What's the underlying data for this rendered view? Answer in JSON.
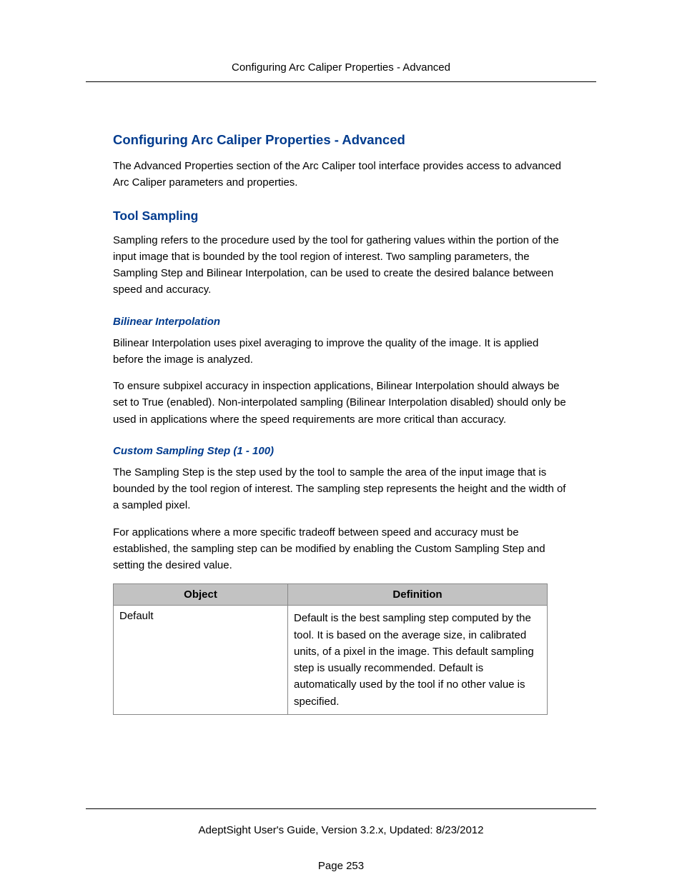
{
  "header": {
    "running_title": "Configuring Arc Caliper Properties - Advanced"
  },
  "content": {
    "h1": "Configuring Arc Caliper Properties - Advanced",
    "intro": "The Advanced Properties section of the Arc Caliper tool interface provides access to advanced Arc Caliper parameters and properties.",
    "h2_tool_sampling": "Tool Sampling",
    "tool_sampling_para": "Sampling refers to the procedure used by the tool for gathering values within the portion of the input image that is bounded by the tool region of interest. Two sampling parameters, the Sampling Step and Bilinear Interpolation, can be used to create the desired balance between speed and accuracy.",
    "h3_bilinear": "Bilinear Interpolation",
    "bilinear_p1": "Bilinear Interpolation uses pixel averaging to improve the quality of the image. It is applied before the image is analyzed.",
    "bilinear_p2": "To ensure subpixel accuracy in inspection applications, Bilinear Interpolation should always be set to True (enabled). Non-interpolated sampling (Bilinear Interpolation disabled) should only be used in applications where the speed requirements are more critical than accuracy.",
    "h3_custom": "Custom Sampling Step (1 - 100)",
    "custom_p1": "The Sampling Step is the step used by the tool to sample the area of the input image that is bounded by the tool region of interest. The sampling step represents the height and the width of a sampled pixel.",
    "custom_p2": "For applications where a more specific tradeoff between speed and accuracy must be established, the sampling step can be modified by enabling the Custom Sampling Step and setting the desired value.",
    "table": {
      "headers": {
        "object": "Object",
        "definition": "Definition"
      },
      "rows": [
        {
          "object": "Default",
          "definition": "Default is the best sampling step computed by the tool. It is based on the average size, in calibrated units, of a pixel in the image. This default sampling step is usually recommended. Default is automatically used by the tool if no other value is specified."
        }
      ]
    }
  },
  "footer": {
    "guide_line": "AdeptSight User's Guide,  Version 3.2.x, Updated: 8/23/2012",
    "page_line": "Page 253"
  }
}
